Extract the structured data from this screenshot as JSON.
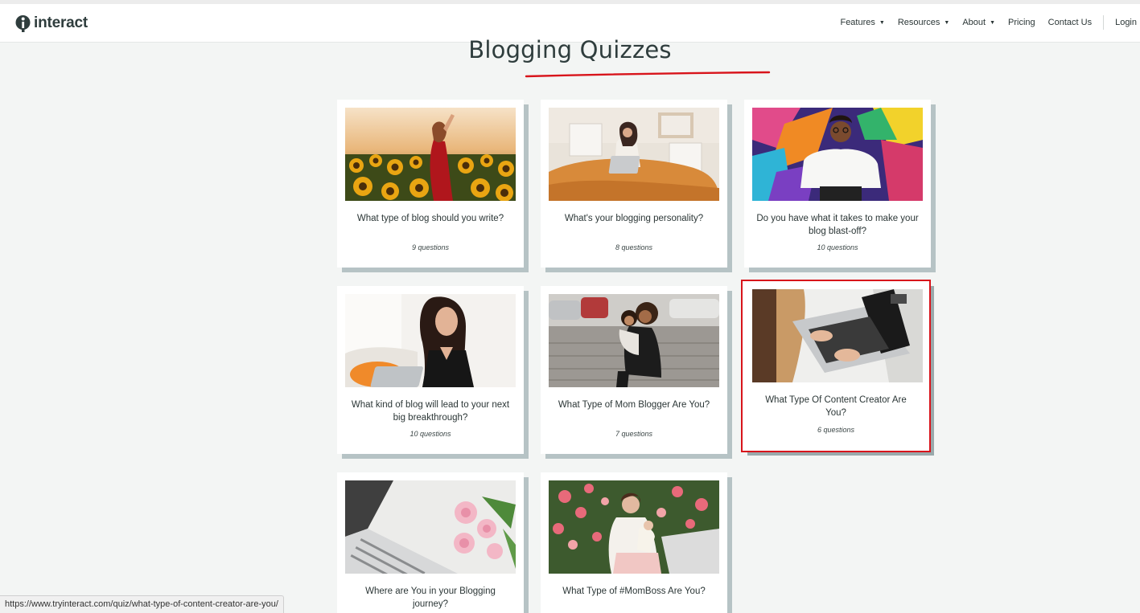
{
  "header": {
    "logo_text": "interact",
    "nav": {
      "features": "Features",
      "resources": "Resources",
      "about": "About",
      "pricing": "Pricing",
      "contact": "Contact Us",
      "login": "Login"
    }
  },
  "page": {
    "title": "Blogging Quizzes",
    "accent_color": "#d8141b"
  },
  "cards": [
    {
      "title": "What type of blog should you write?",
      "count": "9 questions"
    },
    {
      "title": "What's your blogging personality?",
      "count": "8 questions"
    },
    {
      "title": "Do you have what it takes to make your blog blast-off?",
      "count": "10 questions"
    },
    {
      "title": "What kind of blog will lead to your next big breakthrough?",
      "count": "10 questions"
    },
    {
      "title": "What Type of Mom Blogger Are You?",
      "count": "7 questions"
    },
    {
      "title": "What Type Of Content Creator Are You?",
      "count": "6 questions"
    },
    {
      "title": "Where are You in your Blogging journey?",
      "count": ""
    },
    {
      "title": "What Type of #MomBoss Are You?",
      "count": ""
    }
  ],
  "status_url": "https://www.tryinteract.com/quiz/what-type-of-content-creator-are-you/"
}
